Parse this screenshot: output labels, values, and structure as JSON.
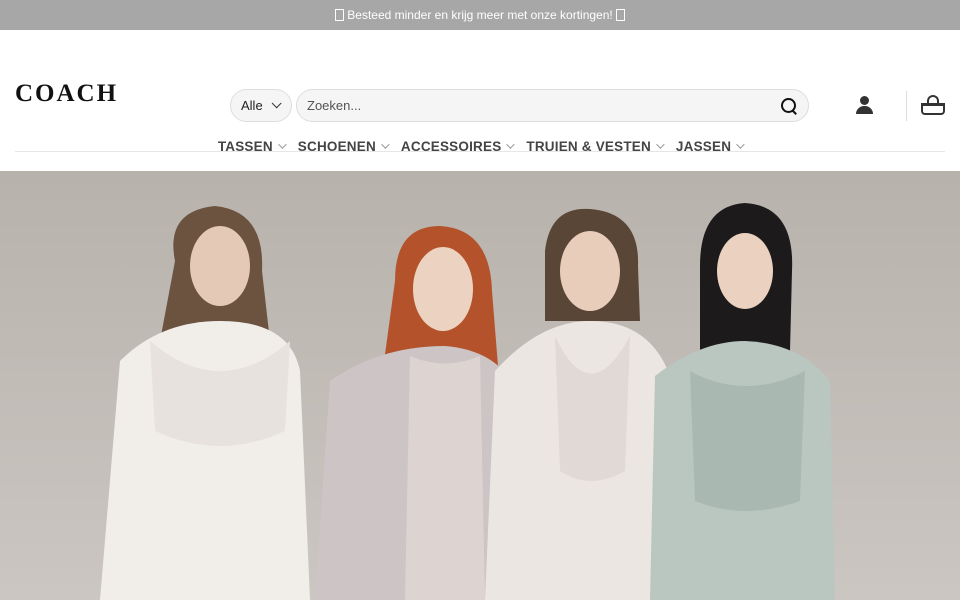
{
  "promo_bar": {
    "text": "Besteed minder en krijg meer met onze kortingen!"
  },
  "brand": {
    "logo_text": "COACH"
  },
  "search": {
    "category": "Alle",
    "placeholder": "Zoeken..."
  },
  "nav": [
    {
      "label": "TASSEN"
    },
    {
      "label": "SCHOENEN"
    },
    {
      "label": "ACCESSOIRES"
    },
    {
      "label": "TRUIEN & VESTEN"
    },
    {
      "label": "JASSEN"
    }
  ],
  "hero": {
    "alt": ""
  },
  "icons": {
    "search": "search-icon",
    "account": "account-icon",
    "cart": "cart-icon"
  }
}
